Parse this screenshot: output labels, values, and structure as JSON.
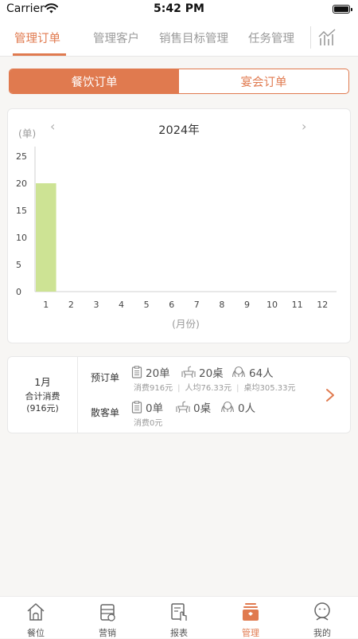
{
  "status_bar": {
    "carrier": "Carrier",
    "time": "5:42 PM"
  },
  "top_tabs": [
    "管理订单",
    "管理客户",
    "销售目标管理",
    "任务管理"
  ],
  "top_tabs_active": 0,
  "segment": {
    "left": "餐饮订单",
    "right": "宴会订单",
    "active": "left"
  },
  "colors": {
    "accent": "#e07a4f",
    "bar": "#cde394",
    "muted": "#9a9a9a"
  },
  "chart_data": {
    "type": "bar",
    "title": "2024年",
    "ylabel": "(单)",
    "xlabel": "(月份)",
    "categories": [
      "1",
      "2",
      "3",
      "4",
      "5",
      "6",
      "7",
      "8",
      "9",
      "10",
      "11",
      "12"
    ],
    "values": [
      20,
      0,
      0,
      0,
      0,
      0,
      0,
      0,
      0,
      0,
      0,
      0
    ],
    "y_ticks": [
      "0",
      "5",
      "10",
      "15",
      "20",
      "25"
    ],
    "ylim": [
      0,
      25
    ],
    "grid": false
  },
  "summary": {
    "month": "1月",
    "total_label": "合计消费",
    "total_value": "(916元)",
    "reserved": {
      "label": "预订单",
      "orders": "20单",
      "tables": "20桌",
      "people": "64人",
      "spend": "消费916元",
      "per_person": "人均76.33元",
      "per_table": "桌均305.33元"
    },
    "walkin": {
      "label": "散客单",
      "orders": "0单",
      "tables": "0桌",
      "people": "0人",
      "spend": "消费0元"
    }
  },
  "bottom_nav": [
    "餐位",
    "营销",
    "报表",
    "管理",
    "我的"
  ],
  "bottom_nav_active": 3
}
